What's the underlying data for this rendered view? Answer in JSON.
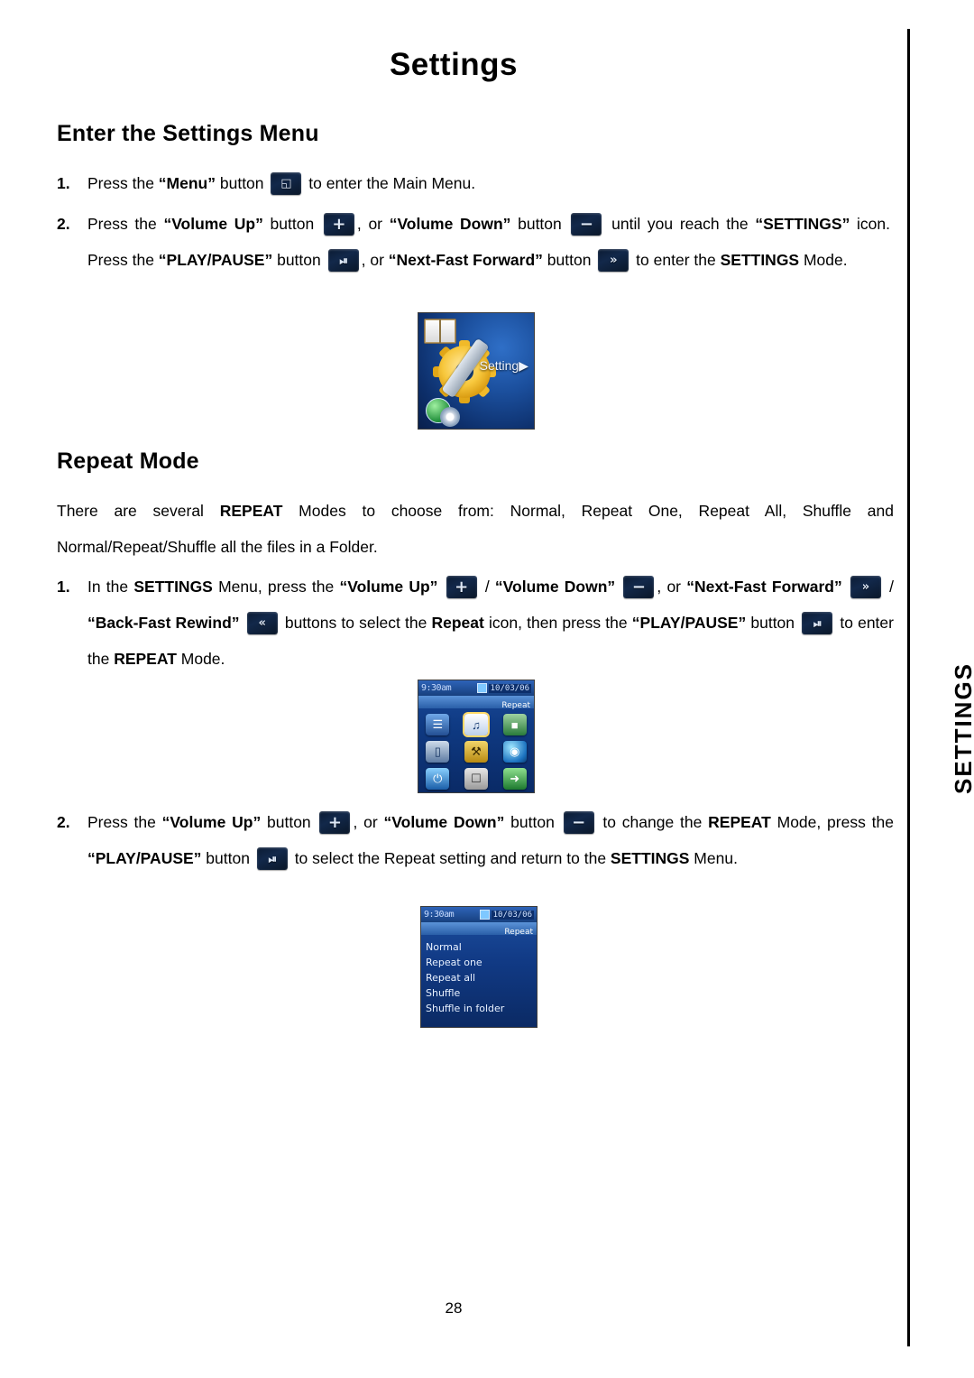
{
  "document": {
    "title": "Settings",
    "page_number": "28",
    "side_tab": "SETTINGS"
  },
  "sections": [
    {
      "heading": "Enter the Settings Menu",
      "steps": [
        {
          "number": "1.",
          "parts": [
            {
              "t": "Press the ",
              "b": false
            },
            {
              "t": "“Menu”",
              "b": true
            },
            {
              "t": " button ",
              "b": false
            },
            {
              "icon": "menu-button-icon"
            },
            {
              "t": " to enter the Main Menu.",
              "b": false
            }
          ]
        },
        {
          "number": "2.",
          "parts": [
            {
              "t": "Press the ",
              "b": false
            },
            {
              "t": "“Volume Up”",
              "b": true
            },
            {
              "t": " button ",
              "b": false
            },
            {
              "icon": "volume-up-button-icon"
            },
            {
              "t": ", or ",
              "b": false
            },
            {
              "t": "“Volume Down”",
              "b": true
            },
            {
              "t": " button ",
              "b": false
            },
            {
              "icon": "volume-down-button-icon"
            },
            {
              "t": " until you reach the ",
              "b": false
            },
            {
              "t": "“SETTINGS”",
              "b": true
            },
            {
              "t": " icon. Press the ",
              "b": false
            },
            {
              "t": "“PLAY/PAUSE”",
              "b": true
            },
            {
              "t": " button ",
              "b": false
            },
            {
              "icon": "play-pause-button-icon"
            },
            {
              "t": ", or ",
              "b": false
            },
            {
              "t": "“Next-Fast Forward”",
              "b": true
            },
            {
              "t": " button ",
              "b": false
            },
            {
              "icon": "next-fast-forward-button-icon"
            },
            {
              "t": " to enter the ",
              "b": false
            },
            {
              "t": "SETTINGS",
              "b": true
            },
            {
              "t": " Mode.",
              "b": false
            }
          ]
        }
      ]
    },
    {
      "heading": "Repeat Mode",
      "intro": "There are several REPEAT Modes to choose from: Normal, Repeat One, Repeat All, Shuffle and Normal/Repeat/Shuffle all the files in a Folder."
    }
  ],
  "text": {
    "enter_step1_a": "Press the ",
    "enter_step1_menu": "“Menu”",
    "enter_step1_b": " button ",
    "enter_step1_c": " to enter the Main Menu.",
    "enter_step2_a": "Press the ",
    "enter_step2_volup": "“Volume Up”",
    "enter_step2_b": " button ",
    "enter_step2_c": ", or ",
    "enter_step2_voldown": "“Volume Down”",
    "enter_step2_d": " button ",
    "enter_step2_e": " until you reach the ",
    "enter_step2_settings": "“SETTINGS”",
    "enter_step2_f": " icon. Press the ",
    "enter_step2_playpause": "“PLAY/PAUSE”",
    "enter_step2_g": " button ",
    "enter_step2_h": ", or ",
    "enter_step2_nextff": "“Next-Fast Forward”",
    "enter_step2_i": " button ",
    "enter_step2_j": " to ",
    "enter_step2_k": "enter the ",
    "enter_step2_settingsmode": "SETTINGS",
    "enter_step2_l": " Mode.",
    "repeat_intro_1": "There are several ",
    "repeat_intro_repeat": "REPEAT",
    "repeat_intro_2": " Modes to choose from: Normal, Repeat One, Repeat All, Shuffle and Normal/Repeat/Shuffle all the files in a Folder.",
    "repeat_step1_a": "In the ",
    "repeat_step1_settings": "SETTINGS",
    "repeat_step1_b": " Menu, press the ",
    "repeat_step1_volup": "“Volume Up”",
    "repeat_step1_slash": " / ",
    "repeat_step1_voldown": "“Volume Down”",
    "repeat_step1_c": ", or ",
    "repeat_step1_nextff": "“Next-Fast Forward”",
    "repeat_step1_slash2": " / ",
    "repeat_step1_backrew": "“Back-Fast Rewind”",
    "repeat_step1_d": " buttons to select the ",
    "repeat_step1_repeaticon": "Repeat",
    "repeat_step1_e": " icon, then press the ",
    "repeat_step1_playpause": "“PLAY/PAUSE”",
    "repeat_step1_f": " button ",
    "repeat_step1_g": " to enter the ",
    "repeat_step1_repeatmode": "REPEAT",
    "repeat_step1_h": " Mode.",
    "repeat_step2_a": "Press the ",
    "repeat_step2_volup": "“Volume Up”",
    "repeat_step2_b": " button ",
    "repeat_step2_c": ", or ",
    "repeat_step2_voldown": "“Volume Down”",
    "repeat_step2_d": " button ",
    "repeat_step2_e": " to change the ",
    "repeat_step2_repeat": "REPEAT",
    "repeat_step2_f": " Mode, press the ",
    "repeat_step2_playpause": "“PLAY/PAUSE”",
    "repeat_step2_g": " button ",
    "repeat_step2_h": " to select the Repeat setting and return to the ",
    "repeat_step2_settings": "SETTINGS",
    "repeat_step2_i": " Menu.",
    "step_num_1": "1.",
    "step_num_2": "2."
  },
  "screenshots": {
    "settings_splash": {
      "label": "Setting",
      "arrow": "▶"
    },
    "repeat_grid": {
      "time": "9:30am",
      "date": "10/03/06",
      "title": "Repeat"
    },
    "repeat_list": {
      "time": "9:30am",
      "date": "10/03/06",
      "title": "Repeat",
      "options": [
        "Normal",
        "Repeat one",
        "Repeat all",
        "Shuffle",
        "Shuffle in folder"
      ],
      "selected": "Normal"
    }
  },
  "buttons": {
    "menu": "◱",
    "volume_up": "+",
    "volume_down": "−",
    "play_pause": "⏯",
    "next_ff": "»",
    "back_rew": "«"
  }
}
